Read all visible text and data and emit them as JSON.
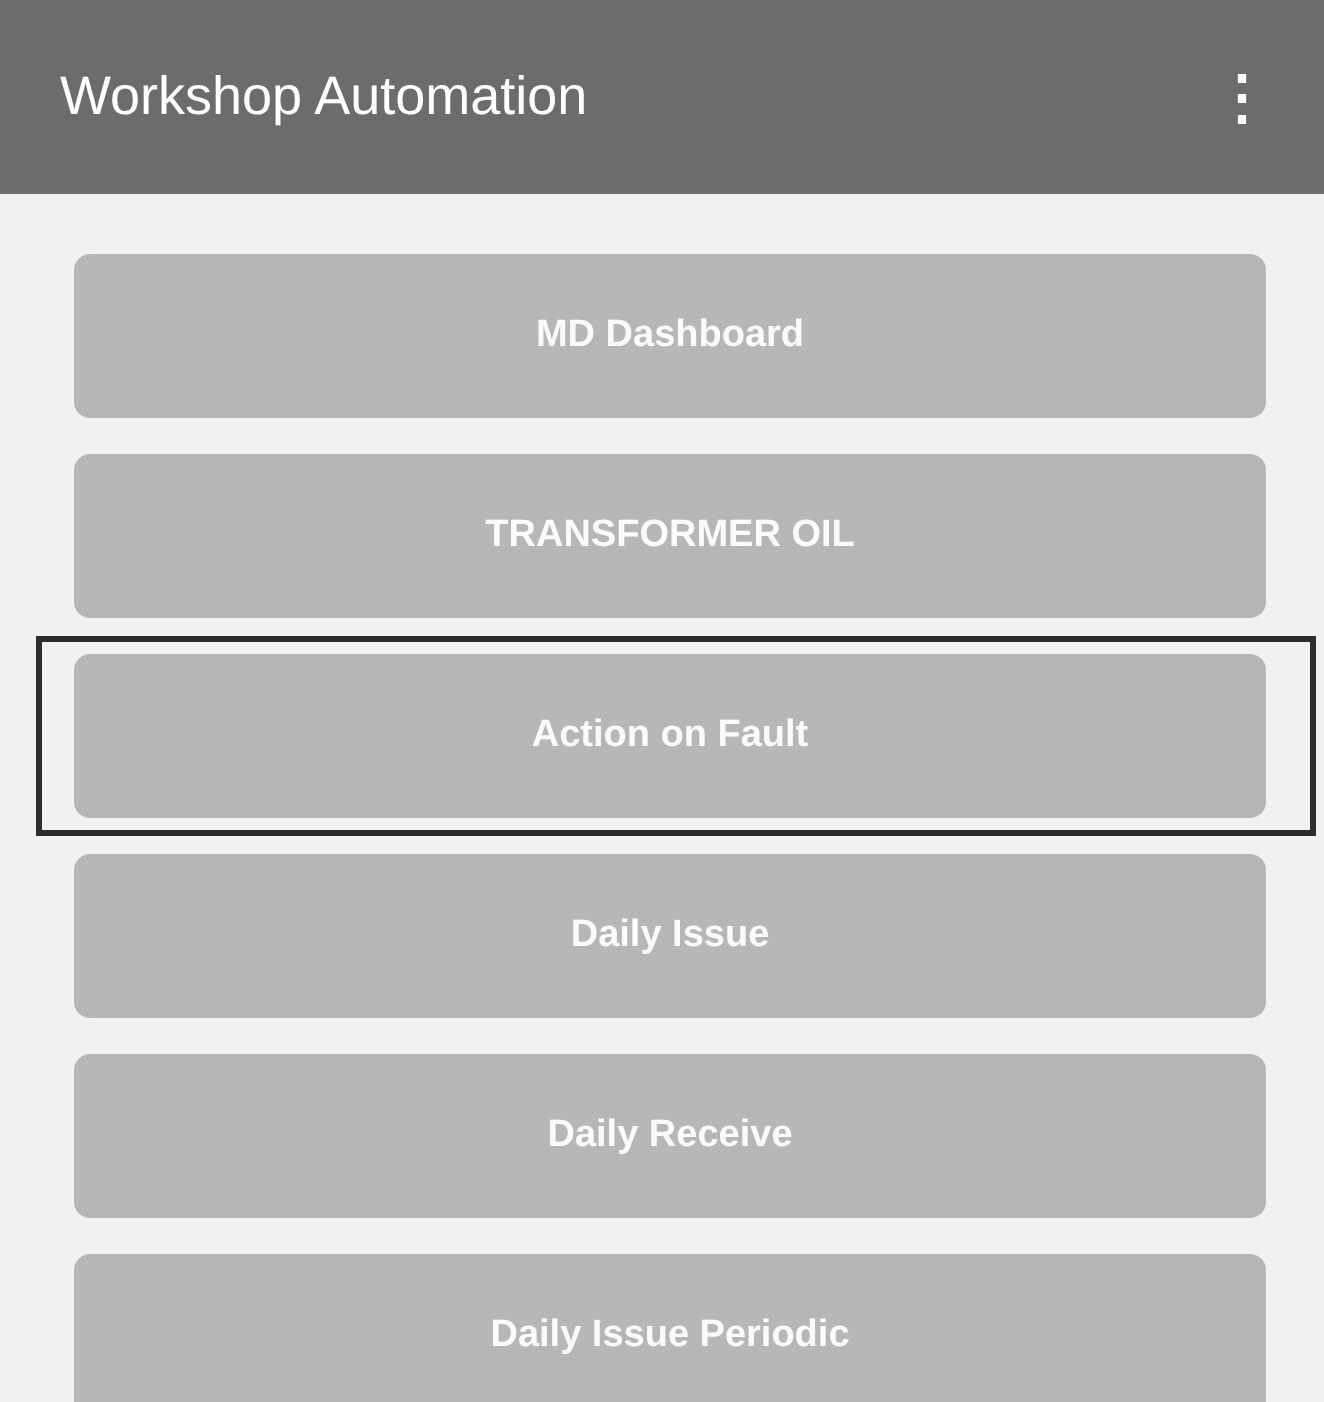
{
  "app_bar": {
    "title": "Workshop Automation",
    "menu_icon": "⋮"
  },
  "menu_items": [
    {
      "label": "MD Dashboard",
      "selected": false
    },
    {
      "label": "TRANSFORMER OIL",
      "selected": false
    },
    {
      "label": "Action on Fault",
      "selected": true
    },
    {
      "label": "Daily Issue",
      "selected": false
    },
    {
      "label": "Daily Receive",
      "selected": false
    },
    {
      "label": "Daily Issue Periodic",
      "selected": false
    }
  ]
}
